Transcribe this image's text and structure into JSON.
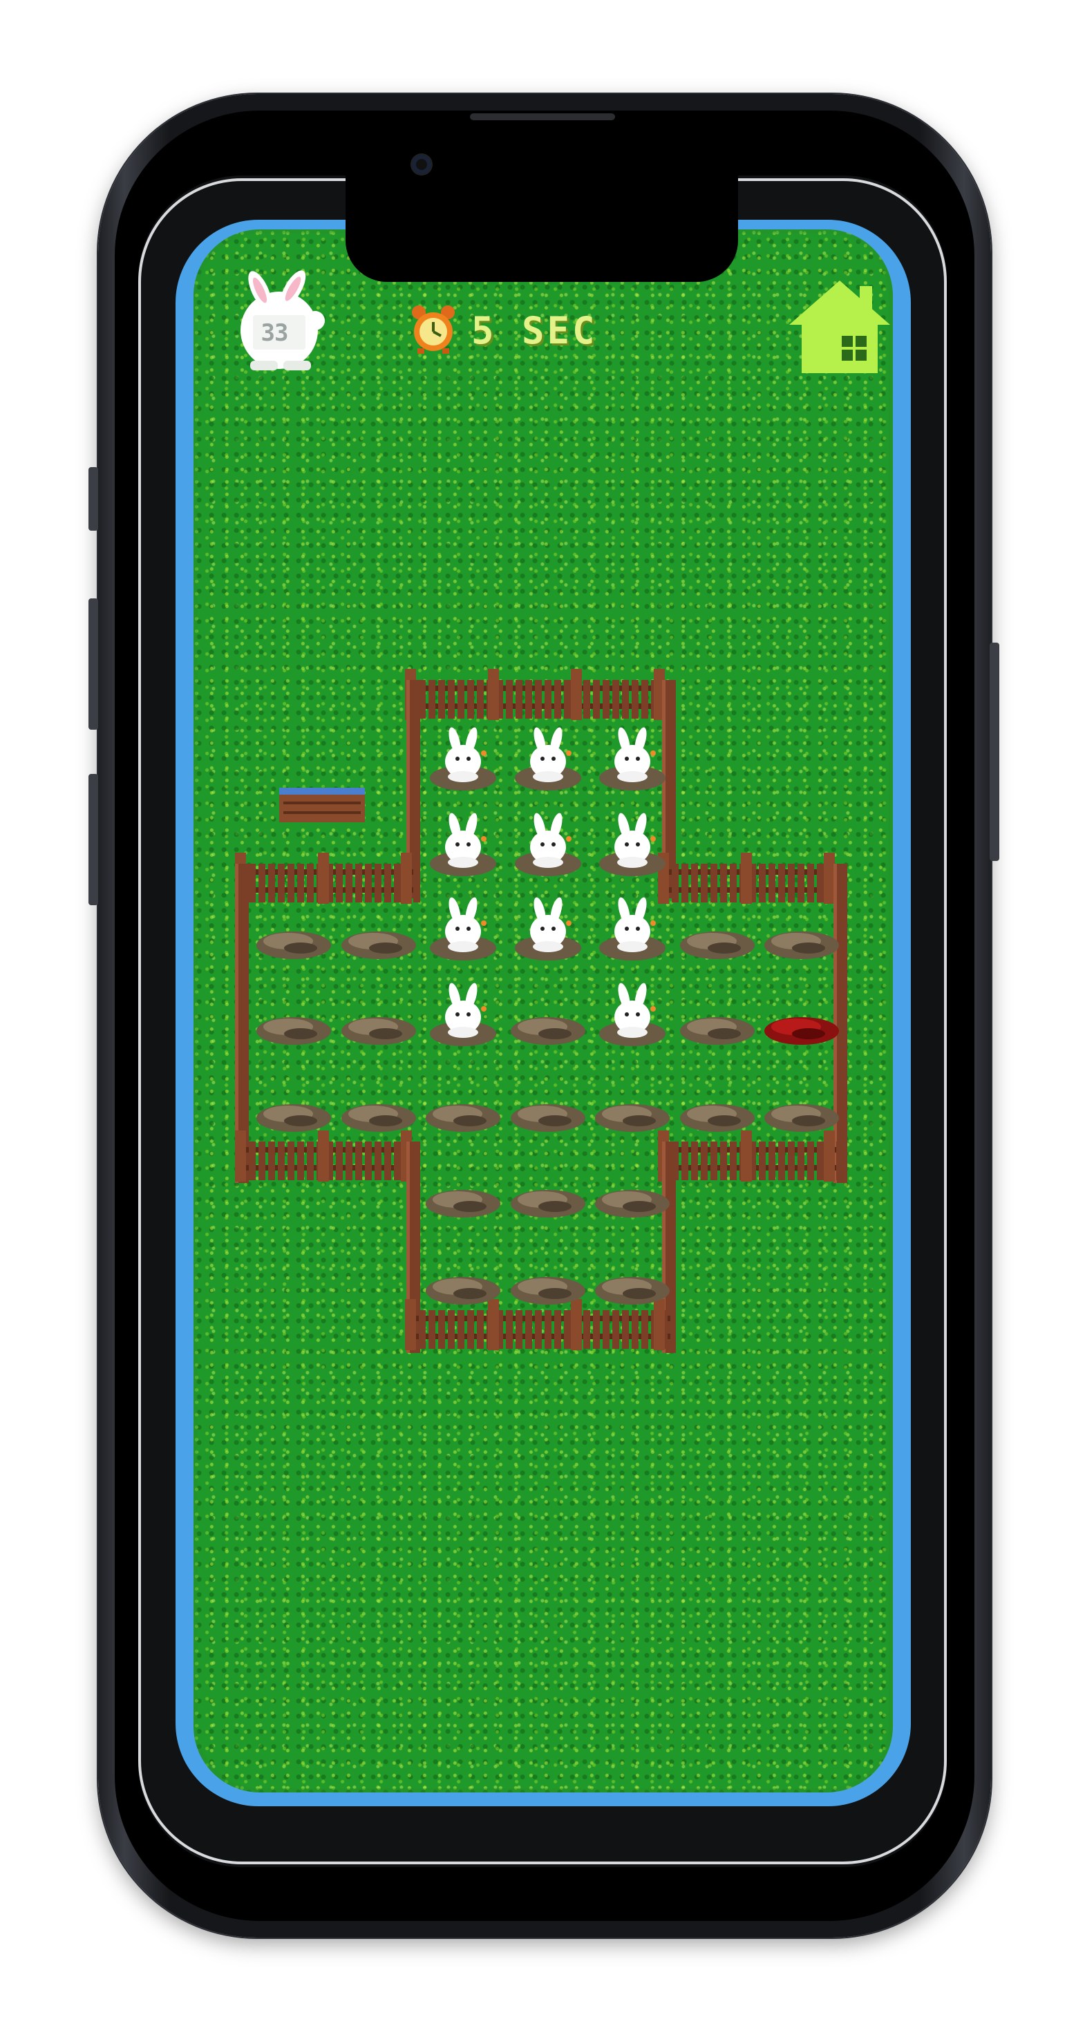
{
  "hud": {
    "bunny_count": "33",
    "timer_text": "5 SEC"
  },
  "icons": {
    "counter": "bunny-counter-icon",
    "timer": "alarm-clock-icon",
    "home": "home-icon"
  },
  "colors": {
    "grass": "#1f9a2a",
    "water": "#4aa3e8",
    "fence": "#7a3f26",
    "home_icon": "#b6f04a",
    "timer_text": "#e4f28a"
  },
  "board": {
    "rows": [
      [
        "empty",
        "empty",
        "bunny",
        "bunny",
        "bunny",
        "empty",
        "empty"
      ],
      [
        "empty",
        "empty",
        "bunny",
        "bunny",
        "bunny",
        "empty",
        "empty"
      ],
      [
        "hole",
        "hole",
        "bunny",
        "bunny",
        "bunny",
        "hole",
        "hole"
      ],
      [
        "hole",
        "hole",
        "bunny",
        "hole",
        "bunny",
        "hole",
        "selected"
      ],
      [
        "hole",
        "hole",
        "hole",
        "hole",
        "hole",
        "hole",
        "hole"
      ],
      [
        "empty",
        "empty",
        "hole",
        "hole",
        "hole",
        "empty",
        "empty"
      ],
      [
        "empty",
        "empty",
        "hole",
        "hole",
        "hole",
        "empty",
        "empty"
      ]
    ]
  }
}
